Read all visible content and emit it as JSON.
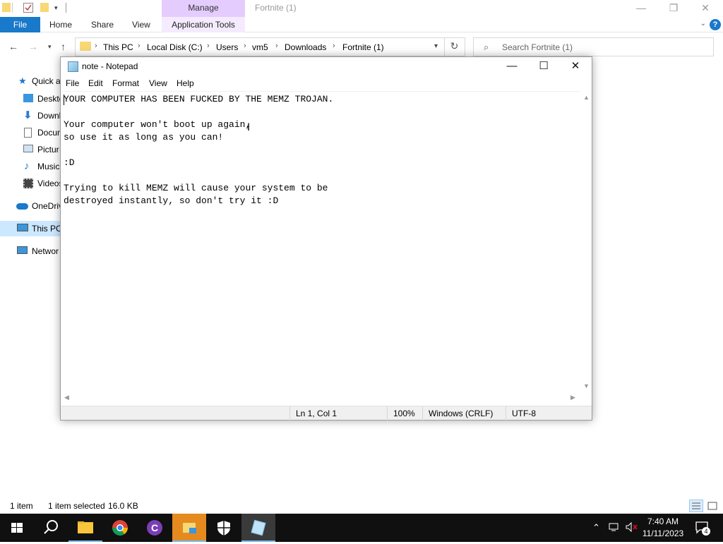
{
  "explorer": {
    "title": "Fortnite (1)",
    "manage_tab": "Manage",
    "ribbon": {
      "file": "File",
      "home": "Home",
      "share": "Share",
      "view": "View",
      "app_tools": "Application Tools"
    },
    "breadcrumb": [
      "This PC",
      "Local Disk (C:)",
      "Users",
      "vm5",
      "Downloads",
      "Fortnite (1)"
    ],
    "search_placeholder": "Search Fortnite (1)",
    "nav": {
      "quick_access": "Quick a",
      "desktop": "Deskto",
      "downloads": "Downl",
      "documents": "Docum",
      "pictures": "Pictur",
      "music": "Music",
      "videos": "Videos",
      "onedrive": "OneDriv",
      "thispc": "This PC",
      "network": "Networ"
    },
    "status": {
      "items": "1 item",
      "selected": "1 item selected",
      "size": "16.0 KB"
    }
  },
  "notepad": {
    "title": "note - Notepad",
    "menu": {
      "file": "File",
      "edit": "Edit",
      "format": "Format",
      "view": "View",
      "help": "Help"
    },
    "content": "YOUR COMPUTER HAS BEEN FUCKED BY THE MEMZ TROJAN.\n\nYour computer won't boot up again,\nso use it as long as you can!\n\n:D\n\nTrying to kill MEMZ will cause your system to be\ndestroyed instantly, so don't try it :D",
    "status": {
      "position": "Ln 1, Col 1",
      "zoom": "100%",
      "line_ending": "Windows (CRLF)",
      "encoding": "UTF-8"
    }
  },
  "taskbar": {
    "clock_time": "7:40 AM",
    "clock_date": "11/11/2023",
    "notification_count": "4"
  },
  "colors": {
    "accent": "#1979ca",
    "manage": "#e5ccff",
    "taskbar": "#101010",
    "selection": "#cce8ff"
  }
}
